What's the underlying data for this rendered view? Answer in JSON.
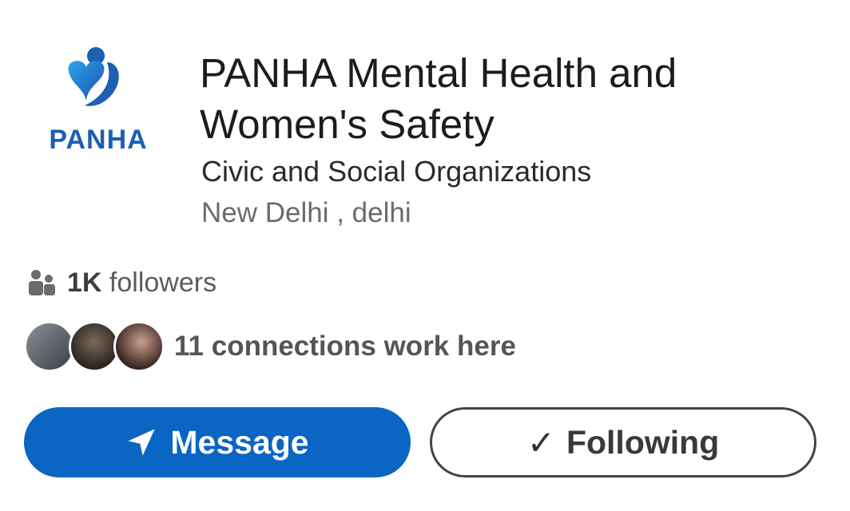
{
  "org": {
    "logo_text": "PANHA",
    "title": "PANHA Mental Health and Women's Safety",
    "industry": "Civic and Social Organizations",
    "location": "New Delhi , delhi"
  },
  "followers": {
    "count": "1K",
    "label": "followers",
    "icon": "people-icon"
  },
  "connections": {
    "text": "11 connections work here"
  },
  "actions": {
    "message_label": "Message",
    "message_icon": "send-icon",
    "following_label": "Following",
    "following_icon": "check-icon"
  },
  "colors": {
    "primary": "#0a66c2",
    "logo_blue": "#1d5fb3"
  }
}
